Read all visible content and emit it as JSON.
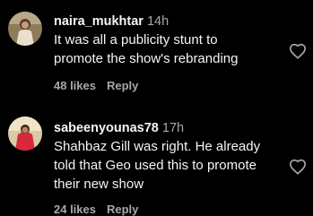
{
  "comments": [
    {
      "username": "naira_mukhtar",
      "time": "14h",
      "lines": [
        "It was all a publicity stunt to",
        "promote the show's rebranding"
      ],
      "likes": "48 likes",
      "reply": "Reply"
    },
    {
      "username": "sabeenyounas78",
      "time": "17h",
      "lines": [
        "Shahbaz Gill was right. He already",
        "told that Geo used this to promote",
        "their new show"
      ],
      "likes": "24 likes",
      "reply": "Reply"
    }
  ],
  "colors": {
    "background": "#000000",
    "text": "#f5f5f5",
    "secondary": "#a8a8a8"
  }
}
